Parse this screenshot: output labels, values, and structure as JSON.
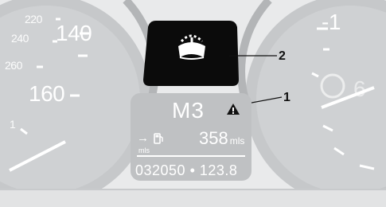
{
  "speedometer": {
    "labels": [
      "220",
      "140",
      "240",
      "260",
      "160",
      "1"
    ]
  },
  "tachometer": {
    "labels": [
      "-1",
      "6"
    ]
  },
  "warning_lamp": {
    "icon": "washer-fluid-icon"
  },
  "info_display": {
    "gear": "M3",
    "warning_icon": "warning-triangle-icon",
    "range_value": "358",
    "range_unit": "mls",
    "fuel_icon": "fuel-pump-icon",
    "mls_label": "mls",
    "odometer": "032050 • 123.8"
  },
  "callouts": {
    "one": "1",
    "two": "2"
  },
  "colors": {
    "panel": "#bdbfc1",
    "lamp_bg": "#0b0b0b",
    "lamp_icon": "#ffffff"
  }
}
